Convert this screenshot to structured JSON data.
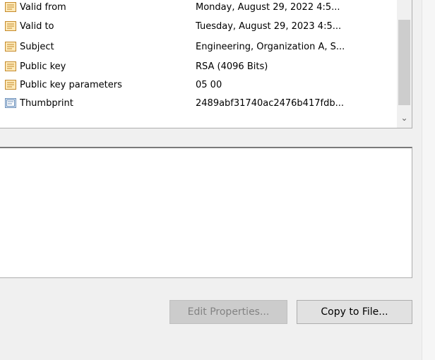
{
  "details": {
    "rows": [
      {
        "field": "Valid from",
        "value": "Monday, August 29, 2022 4:5...",
        "icon": "certificate-field-icon"
      },
      {
        "field": "Valid to",
        "value": "Tuesday, August 29, 2023 4:5...",
        "icon": "certificate-field-icon"
      },
      {
        "field": "Subject",
        "value": "Engineering, Organization A, S...",
        "icon": "certificate-field-icon"
      },
      {
        "field": "Public key",
        "value": "RSA (4096 Bits)",
        "icon": "certificate-field-icon"
      },
      {
        "field": "Public key parameters",
        "value": "05 00",
        "icon": "certificate-field-icon"
      },
      {
        "field": "Thumbprint",
        "value": "2489abf31740ac2476b417fdb...",
        "icon": "certificate-property-icon"
      }
    ],
    "scroll_arrow": "⌄"
  },
  "buttons": {
    "edit_properties": "Edit Properties...",
    "copy_to_file": "Copy to File..."
  },
  "colors": {
    "icon_fill": "#fde9b8",
    "icon_border": "#c58a2b",
    "property_icon_fill": "#dbe8f6",
    "property_icon_border": "#6c8fb8"
  }
}
